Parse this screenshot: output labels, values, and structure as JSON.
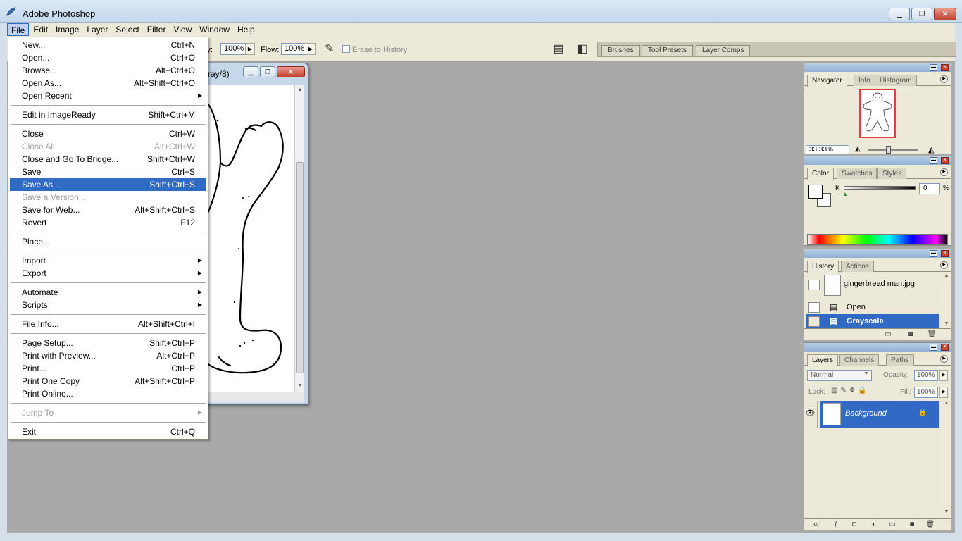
{
  "app": {
    "title": "Adobe Photoshop"
  },
  "window_controls": {
    "minimize": "▁",
    "restore": "❐",
    "close": "✕"
  },
  "menubar": [
    "File",
    "Edit",
    "Image",
    "Layer",
    "Select",
    "Filter",
    "View",
    "Window",
    "Help"
  ],
  "options": {
    "opacity_label": "ity:",
    "opacity_value": "100%",
    "flow_label": "Flow:",
    "flow_value": "100%",
    "erase_to_history": "Erase to History",
    "palette_well_tabs": [
      "Brushes",
      "Tool Presets",
      "Layer Comps"
    ]
  },
  "document": {
    "title_fragment": "ray/8)"
  },
  "file_menu": {
    "items": [
      {
        "label": "New...",
        "shortcut": "Ctrl+N"
      },
      {
        "label": "Open...",
        "shortcut": "Ctrl+O"
      },
      {
        "label": "Browse...",
        "shortcut": "Alt+Ctrl+O"
      },
      {
        "label": "Open As...",
        "shortcut": "Alt+Shift+Ctrl+O"
      },
      {
        "label": "Open Recent",
        "shortcut": ""
      },
      {
        "label": "Edit in ImageReady",
        "shortcut": "Shift+Ctrl+M"
      },
      {
        "label": "Close",
        "shortcut": "Ctrl+W"
      },
      {
        "label": "Close All",
        "shortcut": "Alt+Ctrl+W"
      },
      {
        "label": "Close and Go To Bridge...",
        "shortcut": "Shift+Ctrl+W"
      },
      {
        "label": "Save",
        "shortcut": "Ctrl+S"
      },
      {
        "label": "Save As...",
        "shortcut": "Shift+Ctrl+S"
      },
      {
        "label": "Save a Version...",
        "shortcut": ""
      },
      {
        "label": "Save for Web...",
        "shortcut": "Alt+Shift+Ctrl+S"
      },
      {
        "label": "Revert",
        "shortcut": "F12"
      },
      {
        "label": "Place...",
        "shortcut": ""
      },
      {
        "label": "Import",
        "shortcut": ""
      },
      {
        "label": "Export",
        "shortcut": ""
      },
      {
        "label": "Automate",
        "shortcut": ""
      },
      {
        "label": "Scripts",
        "shortcut": ""
      },
      {
        "label": "File Info...",
        "shortcut": "Alt+Shift+Ctrl+I"
      },
      {
        "label": "Page Setup...",
        "shortcut": "Shift+Ctrl+P"
      },
      {
        "label": "Print with Preview...",
        "shortcut": "Alt+Ctrl+P"
      },
      {
        "label": "Print...",
        "shortcut": "Ctrl+P"
      },
      {
        "label": "Print One Copy",
        "shortcut": "Alt+Shift+Ctrl+P"
      },
      {
        "label": "Print Online...",
        "shortcut": ""
      },
      {
        "label": "Jump To",
        "shortcut": ""
      },
      {
        "label": "Exit",
        "shortcut": "Ctrl+Q"
      }
    ]
  },
  "navigator": {
    "tabs": [
      "Navigator",
      "Info",
      "Histogram"
    ],
    "zoom": "33.33%"
  },
  "color": {
    "tabs": [
      "Color",
      "Swatches",
      "Styles"
    ],
    "channel": "K",
    "value": "0",
    "unit": "%"
  },
  "history": {
    "tabs": [
      "History",
      "Actions"
    ],
    "snapshot": "gingerbread man.jpg",
    "states": [
      "Open",
      "Grayscale"
    ]
  },
  "layers": {
    "tabs": [
      "Layers",
      "Channels",
      "Paths"
    ],
    "blend_mode": "Normal",
    "opacity_label": "Opacity:",
    "opacity": "100%",
    "lock_label": "Lock:",
    "fill_label": "Fill:",
    "fill": "100%",
    "layer_name": "Background"
  },
  "colors": {
    "selection": "#316ac5",
    "menubar": "#ece9d8",
    "workspace": "#a9a9a9"
  }
}
